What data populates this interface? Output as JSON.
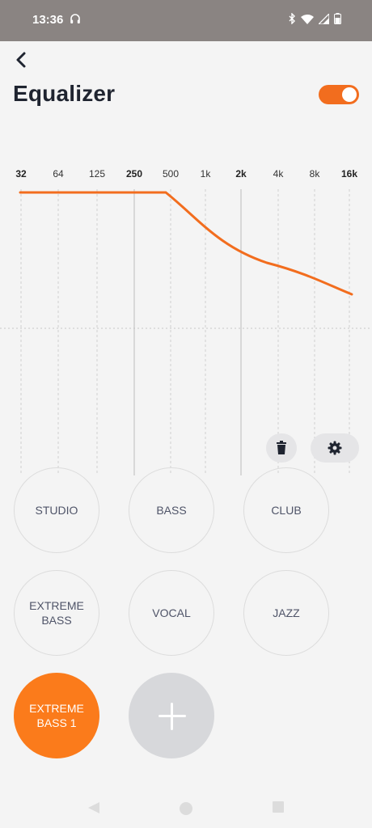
{
  "status_bar": {
    "time": "13:36"
  },
  "header": {
    "title": "Equalizer",
    "enabled": true
  },
  "equalizer": {
    "bands": [
      "32",
      "64",
      "125",
      "250",
      "500",
      "1k",
      "2k",
      "4k",
      "8k",
      "16k"
    ],
    "bold_bands": [
      "32",
      "250",
      "2k",
      "16k"
    ],
    "curve_color": "#f26d1e"
  },
  "presets": [
    {
      "label": "STUDIO",
      "active": false
    },
    {
      "label": "BASS",
      "active": false
    },
    {
      "label": "CLUB",
      "active": false
    },
    {
      "label": "EXTREME BASS",
      "active": false
    },
    {
      "label": "VOCAL",
      "active": false
    },
    {
      "label": "JAZZ",
      "active": false
    },
    {
      "label": "EXTREME BASS 1",
      "active": true
    }
  ],
  "colors": {
    "accent": "#fb7b1b",
    "status_bar": "#8a8482",
    "background": "#f4f4f4"
  }
}
